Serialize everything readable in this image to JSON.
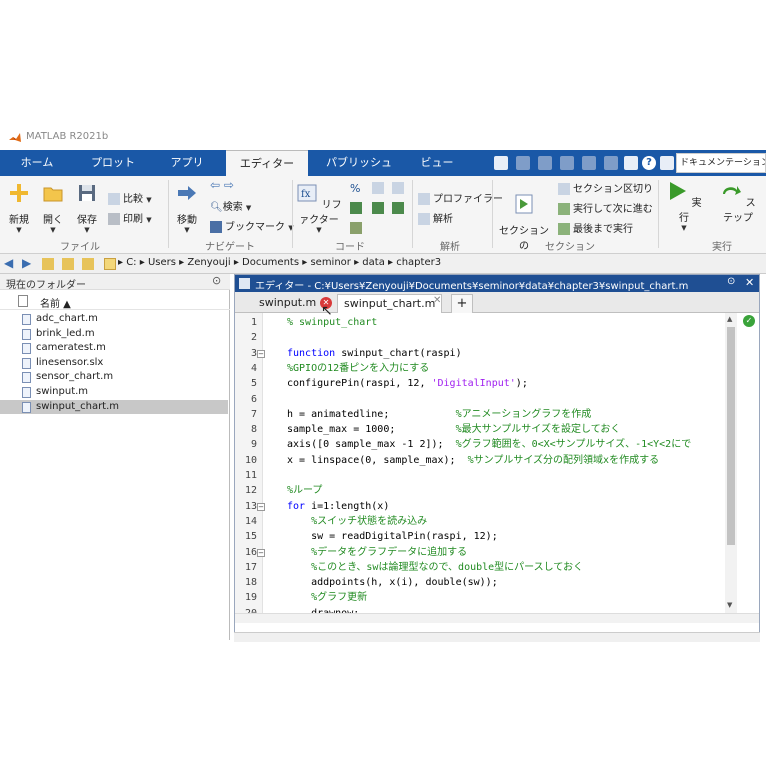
{
  "app": {
    "title": "MATLAB R2021b"
  },
  "ribbon_tabs": [
    "ホーム",
    "プロット",
    "アプリ",
    "エディター",
    "パブリッシュ",
    "ビュー"
  ],
  "active_tab": "エディター",
  "search": {
    "value": "ドキュメンテーションの検"
  },
  "ribbon": {
    "file": {
      "new": "新規",
      "open": "開く",
      "save": "保存",
      "compare": "比較",
      "print": "印刷",
      "group": "ファイル"
    },
    "navigate": {
      "move": "移動",
      "find": "検索",
      "bookmark": "ブックマーク",
      "group": "ナビゲート"
    },
    "code": {
      "refactor": "リファクター",
      "group": "コード"
    },
    "analyze": {
      "profiler": "プロファイラー",
      "analyze": "解析",
      "group": "解析"
    },
    "section": {
      "run_section": "セクションの\n実行",
      "section_break": "セクション区切り",
      "run_advance": "実行して次に進む",
      "run_to_end": "最後まで実行",
      "group": "セクション"
    },
    "run": {
      "run": "実行",
      "step": "ステップ",
      "group": "実行"
    }
  },
  "address": {
    "crumbs": [
      "C:",
      "Users",
      "Zenyouji",
      "Documents",
      "seminor",
      "data",
      "chapter3"
    ]
  },
  "folder_pane": {
    "title": "現在のフォルダー",
    "column": "名前 ▲",
    "files": [
      "adc_chart.m",
      "brink_led.m",
      "cameratest.m",
      "linesensor.slx",
      "sensor_chart.m",
      "swinput.m",
      "swinput_chart.m"
    ],
    "selected": "swinput_chart.m"
  },
  "editor": {
    "title": "エディター - C:¥Users¥Zenyouji¥Documents¥seminor¥data¥chapter3¥swinput_chart.m",
    "tabs": [
      "swinput.m",
      "swinput_chart.m"
    ],
    "add_tab": "+",
    "lines": [
      {
        "n": "1",
        "html": "<span class='cm'>% swinput_chart</span>"
      },
      {
        "n": "2",
        "html": ""
      },
      {
        "n": "3",
        "html": "<span class='kw'>function</span> swinput_chart(raspi)"
      },
      {
        "n": "4",
        "html": "<span class='cm'>%GPIOの12番ピンを入力にする</span>"
      },
      {
        "n": "5",
        "html": "configurePin(raspi, 12, <span class='st'>'DigitalInput'</span>);"
      },
      {
        "n": "6",
        "html": ""
      },
      {
        "n": "7",
        "html": "h = animatedline;           <span class='cm'>%アニメーショングラフを作成</span>"
      },
      {
        "n": "8",
        "html": "sample_max = 1000;          <span class='cm'>%最大サンプルサイズを設定しておく</span>"
      },
      {
        "n": "9",
        "html": "axis([0 sample_max -1 2]);  <span class='cm'>%グラフ範囲を、0&lt;X&lt;サンプルサイズ、-1&lt;Y&lt;2にで</span>"
      },
      {
        "n": "10",
        "html": "x = linspace(0, sample_max);  <span class='cm'>%サンプルサイズ分の配列領域xを作成する</span>"
      },
      {
        "n": "11",
        "html": ""
      },
      {
        "n": "12",
        "html": "<span class='cm'>%ループ</span>"
      },
      {
        "n": "13",
        "html": "<span class='kw'>for</span> i=1:length(x)"
      },
      {
        "n": "14",
        "html": "    <span class='cm'>%スイッチ状態を読み込み</span>"
      },
      {
        "n": "15",
        "html": "    sw = readDigitalPin(raspi, 12);"
      },
      {
        "n": "16",
        "html": "    <span class='cm'>%データをグラフデータに追加する</span>"
      },
      {
        "n": "17",
        "html": "    <span class='cm'>%このとき、swは論理型なので、double型にパースしておく</span>"
      },
      {
        "n": "18",
        "html": "    addpoints(h, x(i), double(sw));"
      },
      {
        "n": "19",
        "html": "    <span class='cm'>%グラフ更新</span>"
      },
      {
        "n": "20",
        "html": "    drawnow;"
      }
    ],
    "fold_lines": [
      "3",
      "13",
      "16"
    ]
  },
  "colors": {
    "ribbon_tab_bg": "#1a58a7",
    "editor_title_bg": "#1f4f93",
    "comment": "#228b22",
    "keyword": "#0000ff",
    "string": "#a020f0"
  }
}
